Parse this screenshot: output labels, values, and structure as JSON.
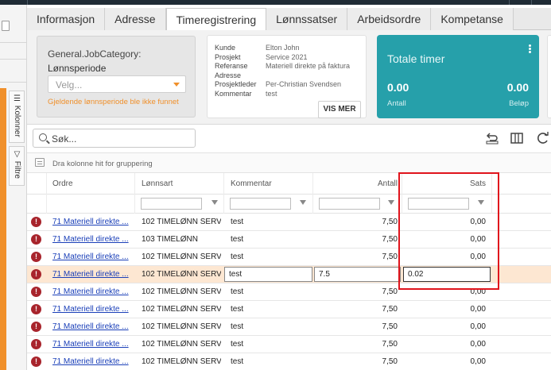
{
  "tabs": [
    {
      "label": "Informasjon",
      "active": false
    },
    {
      "label": "Adresse",
      "active": false
    },
    {
      "label": "Timeregistrering",
      "active": true
    },
    {
      "label": "Lønnssatser",
      "active": false
    },
    {
      "label": "Arbeidsordre",
      "active": false
    },
    {
      "label": "Kompetanse",
      "active": false
    }
  ],
  "side_panels": {
    "columns_label": "Kolonner",
    "filter_label": "Filtre"
  },
  "category_card": {
    "title": "General.JobCategory:",
    "period_label": "Lønnsperiode",
    "select_placeholder": "Velg...",
    "warning": "Gjeldende lønnsperiode ble ikke funnet"
  },
  "info_card": {
    "fields": [
      {
        "key": "Kunde",
        "value": "Elton John"
      },
      {
        "key": "Prosjekt",
        "value": "Service 2021"
      },
      {
        "key": "Referanse",
        "value": "Materiell direkte på faktura"
      },
      {
        "key": "Adresse",
        "value": ""
      },
      {
        "key": "Prosjektleder",
        "value": "Per-Christian Svendsen"
      },
      {
        "key": "Kommentar",
        "value": "test"
      }
    ],
    "more_button": "VIS MER"
  },
  "totals_card": {
    "title": "Totale timer",
    "count_value": "0.00",
    "count_label": "Antall",
    "amount_value": "0.00",
    "amount_label": "Beløp",
    "accent": "#26a0aa"
  },
  "toolbar": {
    "search_placeholder": "Søk...",
    "icons": [
      "undo-icon",
      "columns-icon",
      "refresh-icon"
    ]
  },
  "group_hint": "Dra kolonne hit for gruppering",
  "grid": {
    "columns": [
      "Ordre",
      "Lønnsart",
      "Kommentar",
      "Antall",
      "Sats"
    ],
    "rows": [
      {
        "ordre": "71 Materiell direkte ...",
        "lonnsart": "102 TIMELØNN SERV...",
        "kommentar": "test",
        "antall": "7,50",
        "sats": "0,00",
        "editing": false
      },
      {
        "ordre": "71 Materiell direkte ...",
        "lonnsart": "103 TIMELØNN",
        "kommentar": "test",
        "antall": "7,50",
        "sats": "0,00",
        "editing": false
      },
      {
        "ordre": "71 Materiell direkte ...",
        "lonnsart": "102 TIMELØNN SERV...",
        "kommentar": "test",
        "antall": "7,50",
        "sats": "0,00",
        "editing": false
      },
      {
        "ordre": "71 Materiell direkte ...",
        "lonnsart": "102 TIMELØNN SERV...",
        "kommentar": "test",
        "antall": "7.5",
        "sats": "0.02",
        "editing": true
      },
      {
        "ordre": "71 Materiell direkte ...",
        "lonnsart": "102 TIMELØNN SERV...",
        "kommentar": "test",
        "antall": "7,50",
        "sats": "0,00",
        "editing": false
      },
      {
        "ordre": "71 Materiell direkte ...",
        "lonnsart": "102 TIMELØNN SERV...",
        "kommentar": "test",
        "antall": "7,50",
        "sats": "0,00",
        "editing": false
      },
      {
        "ordre": "71 Materiell direkte ...",
        "lonnsart": "102 TIMELØNN SERV...",
        "kommentar": "test",
        "antall": "7,50",
        "sats": "0,00",
        "editing": false
      },
      {
        "ordre": "71 Materiell direkte ...",
        "lonnsart": "102 TIMELØNN SERV...",
        "kommentar": "test",
        "antall": "7,50",
        "sats": "0,00",
        "editing": false
      },
      {
        "ordre": "71 Materiell direkte ...",
        "lonnsart": "102 TIMELØNN SERV...",
        "kommentar": "test",
        "antall": "7,50",
        "sats": "0,00",
        "editing": false
      }
    ]
  },
  "colors": {
    "error": "#a8242c",
    "selected_row": "#fde7d2",
    "highlight_box": "#e0141c",
    "orange": "#f0902b"
  }
}
